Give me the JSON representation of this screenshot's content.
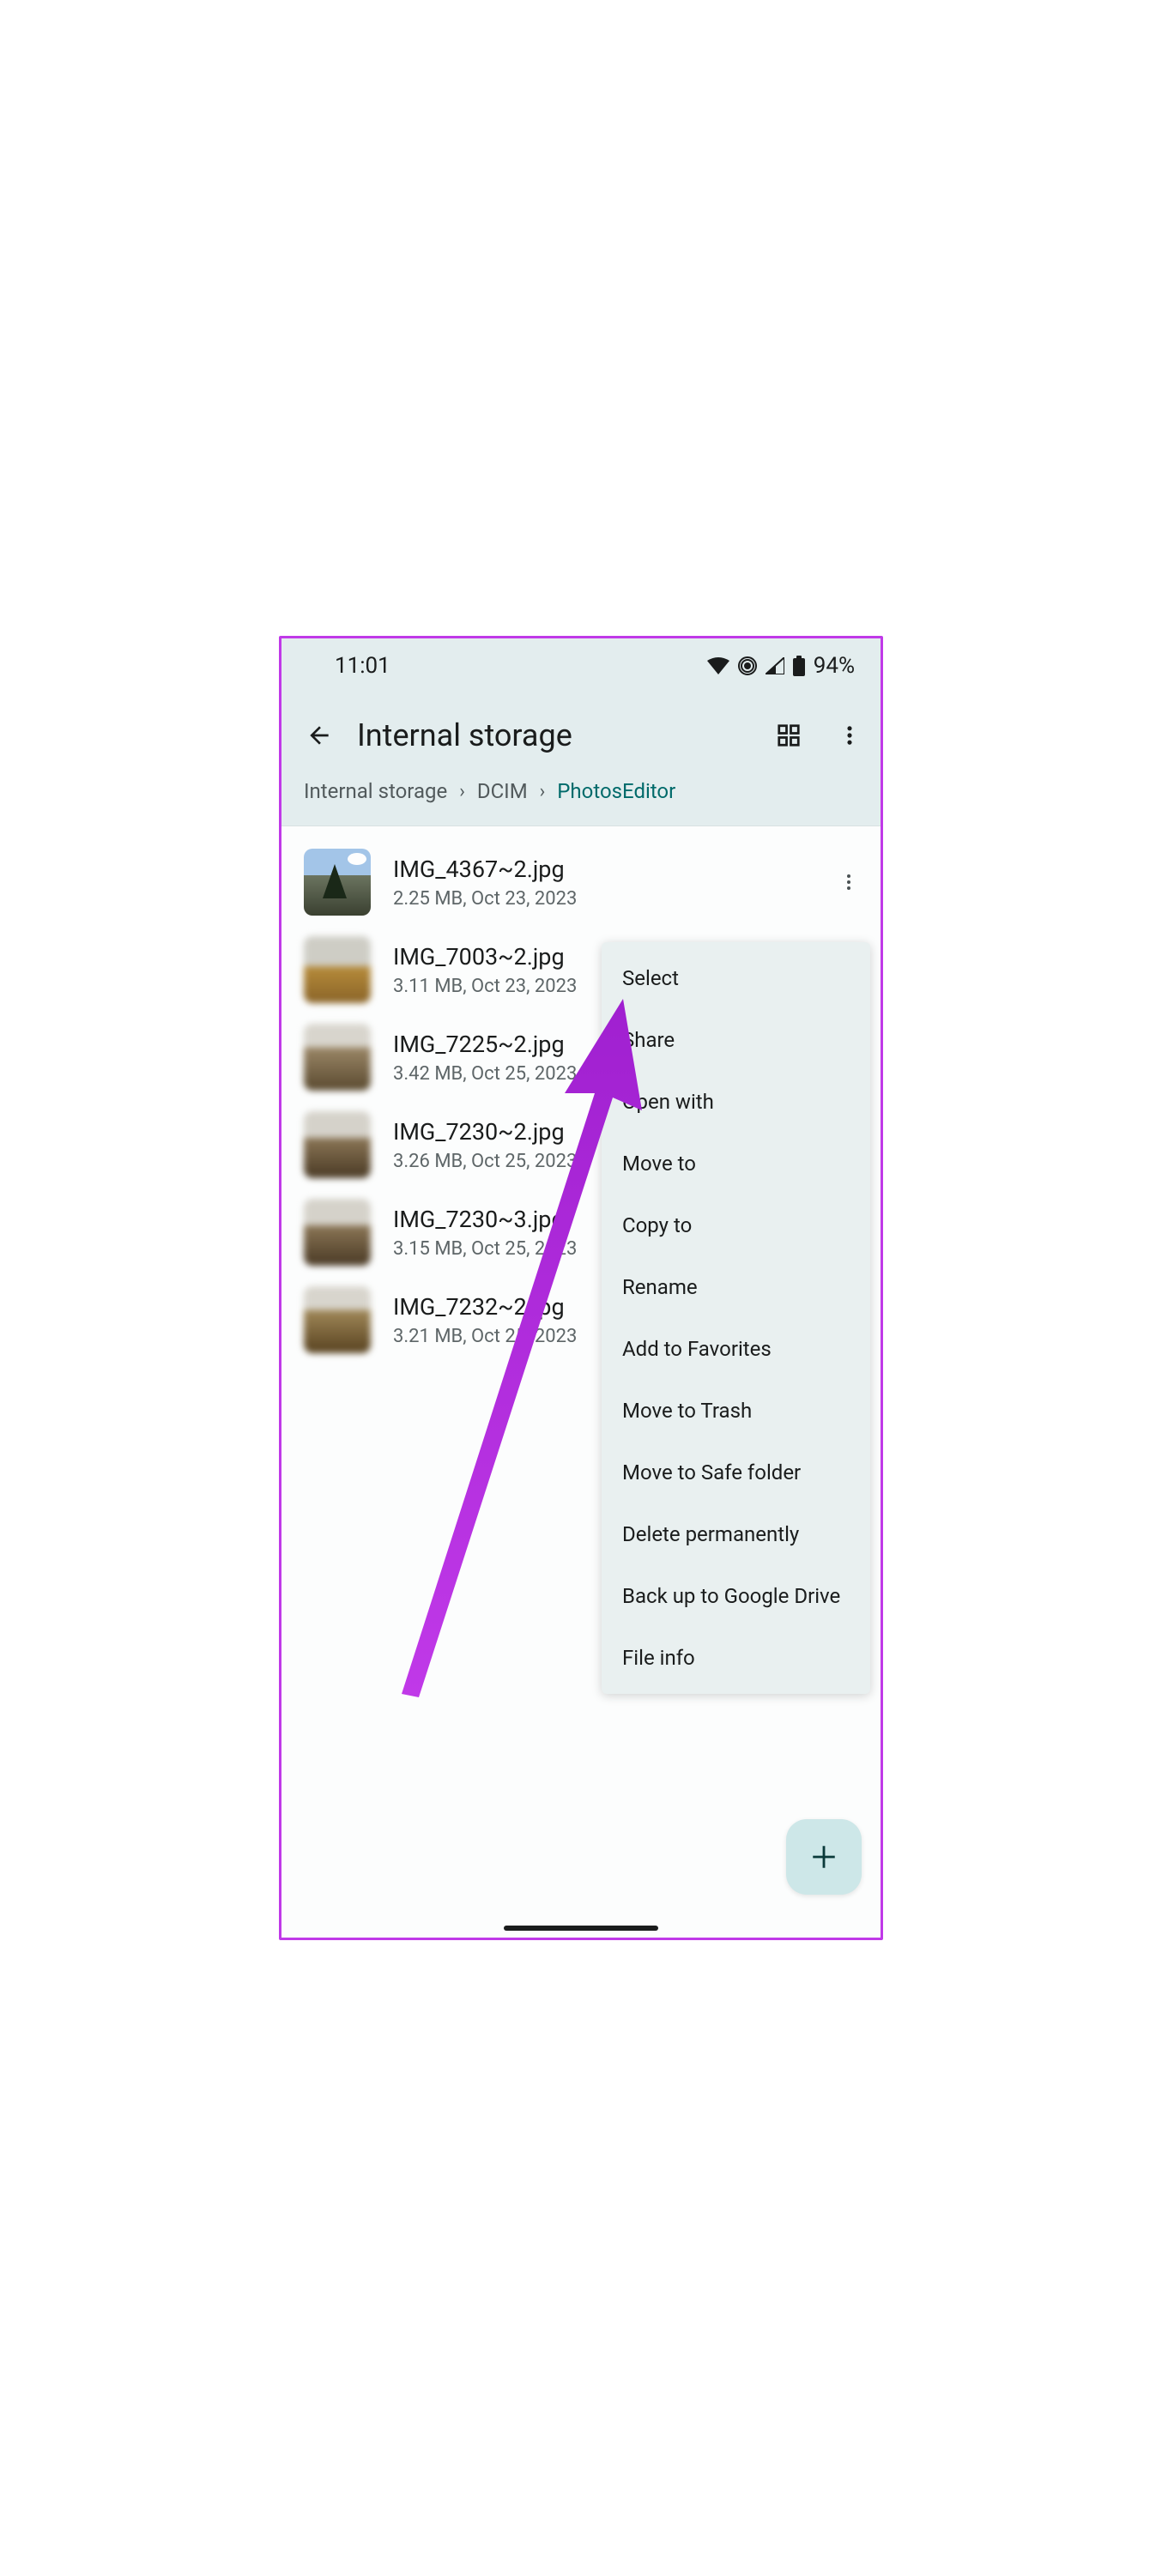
{
  "status": {
    "time": "11:01",
    "battery": "94%"
  },
  "header": {
    "title": "Internal storage"
  },
  "breadcrumb": {
    "items": [
      {
        "label": "Internal storage"
      },
      {
        "label": "DCIM"
      },
      {
        "label": "PhotosEditor"
      }
    ]
  },
  "files": [
    {
      "name": "IMG_4367~2.jpg",
      "meta": "2.25 MB, Oct 23, 2023"
    },
    {
      "name": "IMG_7003~2.jpg",
      "meta": "3.11 MB, Oct 23, 2023"
    },
    {
      "name": "IMG_7225~2.jpg",
      "meta": "3.42 MB, Oct 25, 2023"
    },
    {
      "name": "IMG_7230~2.jpg",
      "meta": "3.26 MB, Oct 25, 2023"
    },
    {
      "name": "IMG_7230~3.jpg",
      "meta": "3.15 MB, Oct 25, 2023"
    },
    {
      "name": "IMG_7232~2.jpg",
      "meta": "3.21 MB, Oct 25, 2023"
    }
  ],
  "menu": {
    "items": [
      {
        "label": "Select"
      },
      {
        "label": "Share"
      },
      {
        "label": "Open with"
      },
      {
        "label": "Move to"
      },
      {
        "label": "Copy to"
      },
      {
        "label": "Rename"
      },
      {
        "label": "Add to Favorites"
      },
      {
        "label": "Move to Trash"
      },
      {
        "label": "Move to Safe folder"
      },
      {
        "label": "Delete permanently"
      },
      {
        "label": "Back up to Google Drive"
      },
      {
        "label": "File info"
      }
    ]
  }
}
